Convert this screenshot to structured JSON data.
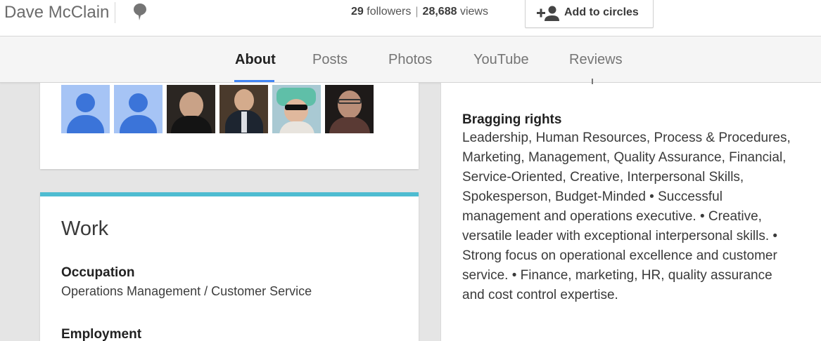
{
  "header": {
    "name": "Dave McClain",
    "followers_count": "29",
    "followers_label": "followers",
    "views_count": "28,688",
    "views_label": "views",
    "separator": "|",
    "add_button_label": "Add to circles",
    "pin_icon": "location-pin-icon",
    "add_icon": "person-add-icon"
  },
  "nav": {
    "tabs": [
      {
        "label": "About",
        "active": true
      },
      {
        "label": "Posts",
        "active": false
      },
      {
        "label": "Photos",
        "active": false
      },
      {
        "label": "YouTube",
        "active": false
      },
      {
        "label": "Reviews",
        "active": false
      }
    ],
    "accent": "#4285f4"
  },
  "people": {
    "avatars": [
      "generic-avatar",
      "generic-avatar",
      "photo-elderly-man",
      "photo-man-suit",
      "photo-woman-sunglasses",
      "photo-man-glasses"
    ]
  },
  "work": {
    "title": "Work",
    "accent": "#4ebcd1",
    "occupation_label": "Occupation",
    "occupation_value": "Operations Management / Customer Service",
    "employment_label": "Employment"
  },
  "bragging": {
    "title": "Bragging rights",
    "lines": [
      "Leadership, Human Resources, Process & Procedures,",
      "Marketing, Management, Quality Assurance, Financial,",
      "Service-Oriented, Creative, Interpersonal Skills,",
      "Spokesperson, Budget-Minded • Successful",
      "management and operations executive. • Creative,",
      "versatile leader with exceptional interpersonal skills. •",
      "Strong focus on operational excellence and customer",
      "service. • Finance, marketing, HR, quality assurance",
      "and cost control expertise."
    ]
  }
}
